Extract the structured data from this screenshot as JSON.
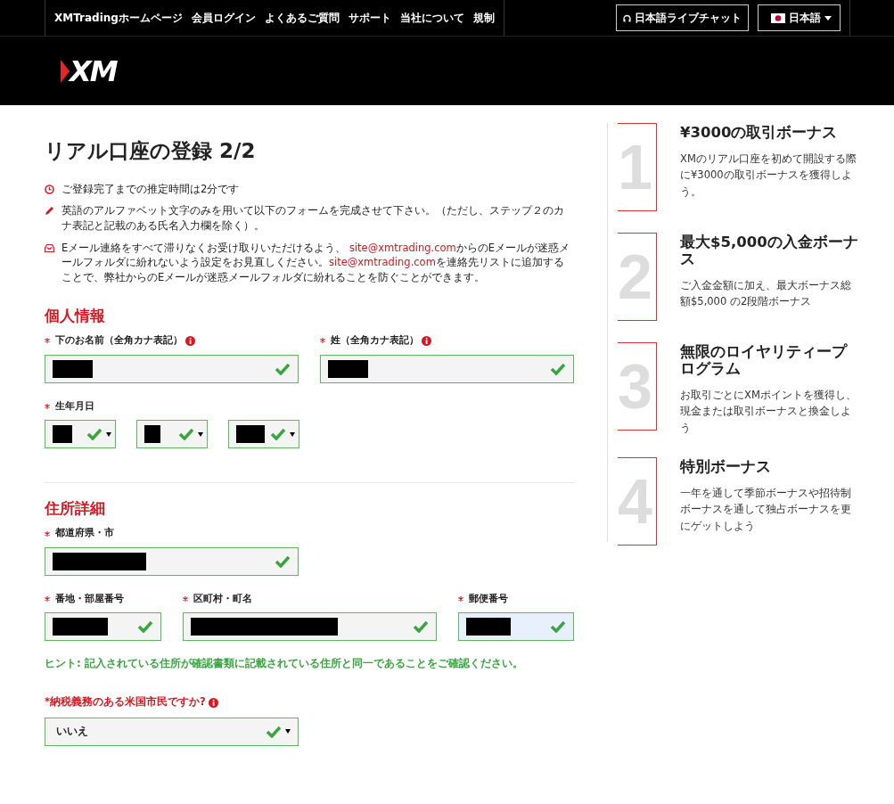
{
  "topbar": {
    "links": [
      "XMTradingホームページ",
      "会員ログイン",
      "よくあるご質問",
      "サポート",
      "当社について",
      "規制"
    ],
    "chat_button": "日本語ライブチャット",
    "language": "日本語"
  },
  "logo": {
    "text": "XM"
  },
  "page_title": "リアル口座の登録 2/2",
  "notices": [
    {
      "kind": "clock",
      "parts": [
        {
          "kind": "text",
          "text": "ご登録完了までの推定時間は2分です"
        }
      ]
    },
    {
      "kind": "pencil",
      "parts": [
        {
          "kind": "text",
          "text": "英語のアルファベット文字のみを用いて以下のフォームを完成させて下さい。（ただし、ステップ２のカナ表記と記載のある氏名入力欄を除く）。"
        }
      ]
    },
    {
      "kind": "mail",
      "parts": [
        {
          "kind": "text",
          "text": "Eメール連絡をすべて滞りなくお受け取りいただけるよう、 "
        },
        {
          "kind": "link",
          "text": "site@xmtrading.com"
        },
        {
          "kind": "text",
          "text": "からのEメールが迷惑メールフォルダに紛れないよう設定をお見直しください。"
        },
        {
          "kind": "link",
          "text": "site@xmtrading.com"
        },
        {
          "kind": "text",
          "text": "を連絡先リストに追加することで、弊社からのEメールが迷惑メールフォルダに紛れることを防ぐことができます。"
        }
      ]
    }
  ],
  "sections": [
    {
      "title": "個人情報",
      "divider": true,
      "rows": [
        {
          "kind": "half",
          "fields": [
            {
              "label": "下のお名前（全角カナ表記）",
              "required": true,
              "info": true,
              "kind": "input",
              "redacted": true,
              "valid": true,
              "autofilled": false
            },
            {
              "label": "姓（全角カナ表記）",
              "required": true,
              "info": true,
              "kind": "input",
              "redacted": true,
              "valid": true,
              "autofilled": false
            }
          ]
        },
        {
          "kind": "date",
          "label": "生年月日",
          "required": true,
          "fields": [
            {
              "kind": "select",
              "redacted": true,
              "valid": true,
              "autofilled": false
            },
            {
              "kind": "select",
              "redacted": true,
              "valid": true,
              "autofilled": false
            },
            {
              "kind": "select",
              "redacted": true,
              "valid": true,
              "autofilled": false
            }
          ]
        }
      ]
    },
    {
      "title": "住所詳細",
      "divider": false,
      "rows": [
        {
          "kind": "half",
          "fields": [
            {
              "label": "都道府県・市",
              "required": true,
              "info": false,
              "kind": "input",
              "redacted": true,
              "valid": true,
              "autofilled": false
            }
          ]
        },
        {
          "kind": "address",
          "fields": [
            {
              "label": "番地・部屋番号",
              "required": true,
              "info": false,
              "kind": "input",
              "redacted": true,
              "valid": true,
              "autofilled": false
            },
            {
              "label": "区町村・町名",
              "required": true,
              "info": false,
              "kind": "input",
              "redacted": true,
              "valid": true,
              "autofilled": false
            },
            {
              "label": "郵便番号",
              "required": true,
              "info": false,
              "kind": "input",
              "redacted": true,
              "valid": true,
              "autofilled": true
            }
          ]
        }
      ]
    }
  ],
  "hint": "ヒント: 記入されている住所が確認書類に記載されている住所と同一であることをご確認ください。",
  "us_question": {
    "label": "*納税義務のある米国市民ですか?",
    "info": true,
    "value": "いいえ",
    "valid": true
  },
  "benefits": [
    {
      "number": "1",
      "title": "¥3000の取引ボーナス",
      "text": "XMのリアル口座を初めて開設する際に¥3000の取引ボーナスを獲得しよう。"
    },
    {
      "number": "2",
      "title": "最大$5,000の入金ボーナス",
      "text": "ご入金金額に加え、最大ボーナス総額$5,000 の2段階ボーナス"
    },
    {
      "number": "3",
      "title": "無限のロイヤリティープログラム",
      "text": "お取引ごとにXMポイントを獲得し、現金または取引ボーナスと換金しよう"
    },
    {
      "number": "4",
      "title": "特別ボーナス",
      "text": "一年を通して季節ボーナスや招待制ボーナスを通して独占ボーナスを更にゲットしよう"
    }
  ]
}
